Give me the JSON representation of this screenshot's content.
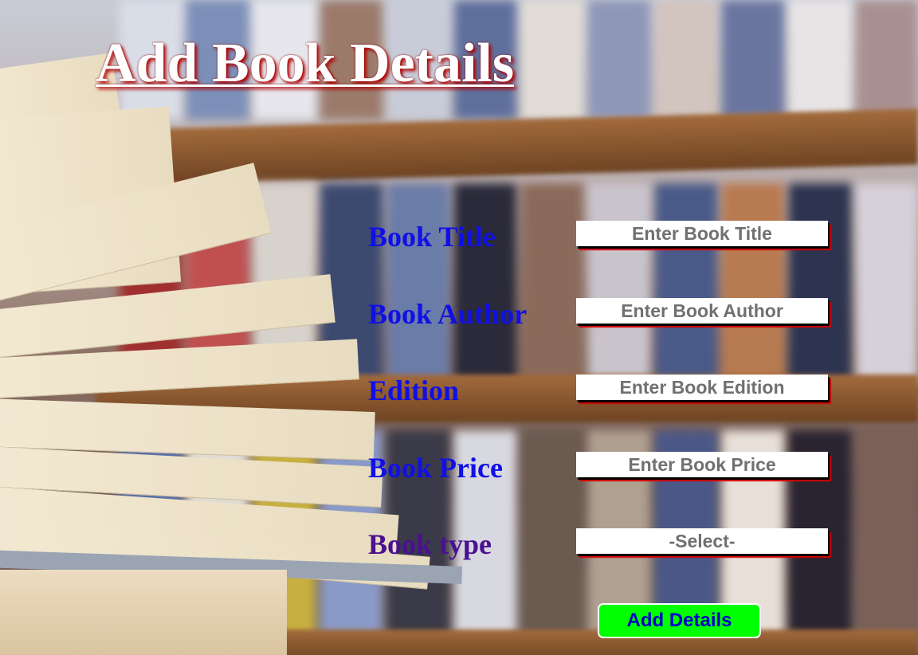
{
  "page": {
    "title": "Add Book Details"
  },
  "form": {
    "fields": [
      {
        "label": "Book Title",
        "placeholder": "Enter Book Title",
        "value": ""
      },
      {
        "label": "Book Author",
        "placeholder": "Enter Book Author",
        "value": ""
      },
      {
        "label": "Edition",
        "placeholder": "Enter Book Edition",
        "value": ""
      },
      {
        "label": "Book Price",
        "placeholder": "Enter Book Price",
        "value": ""
      }
    ],
    "book_type": {
      "label": "Book type",
      "selected": "-Select-"
    },
    "submit_label": "Add Details"
  },
  "colors": {
    "title_text": "#ffffff",
    "title_shadow": "#b00000",
    "label_text": "#1010e6",
    "book_type_label": "#4a1090",
    "field_text": "#707070",
    "field_shadow": "#d40000",
    "submit_bg": "#00ff00",
    "submit_text": "#0000c8"
  }
}
